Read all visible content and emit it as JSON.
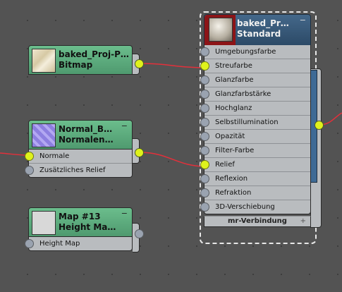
{
  "nodes": {
    "bitmap": {
      "title": "baked_Proj-P…",
      "subtitle": "Bitmap"
    },
    "normal": {
      "title": "Normal_B…",
      "subtitle": "Normalen…",
      "slots": [
        "Normale",
        "Zusätzliches Relief"
      ]
    },
    "map13": {
      "title": "Map #13",
      "subtitle": "Height Ma…",
      "slots": [
        "Height Map"
      ]
    },
    "material": {
      "title": "baked_Pr…",
      "subtitle": "Standard",
      "slots": [
        "Umgebungsfarbe",
        "Streufarbe",
        "Glanzfarbe",
        "Glanzfarbstärke",
        "Hochglanz",
        "Selbstillumination",
        "Opazität",
        "Filter-Farbe",
        "Relief",
        "Reflexion",
        "Refraktion",
        "3D-Verschiebung"
      ],
      "connected_slots": [
        "Streufarbe",
        "Relief"
      ],
      "footer": "mr-Verbindung",
      "footer_button": "+"
    }
  },
  "minimize_glyph": "−",
  "colors": {
    "canvas": "#535353",
    "map_header": "#5aa87c",
    "material_header": "#35587a",
    "wire": "#e3303b",
    "active_port": "#dff21c"
  },
  "icons": [
    "bitmap-thumbnail",
    "normal-map-thumbnail",
    "blank-thumbnail",
    "material-sphere-thumbnail"
  ]
}
